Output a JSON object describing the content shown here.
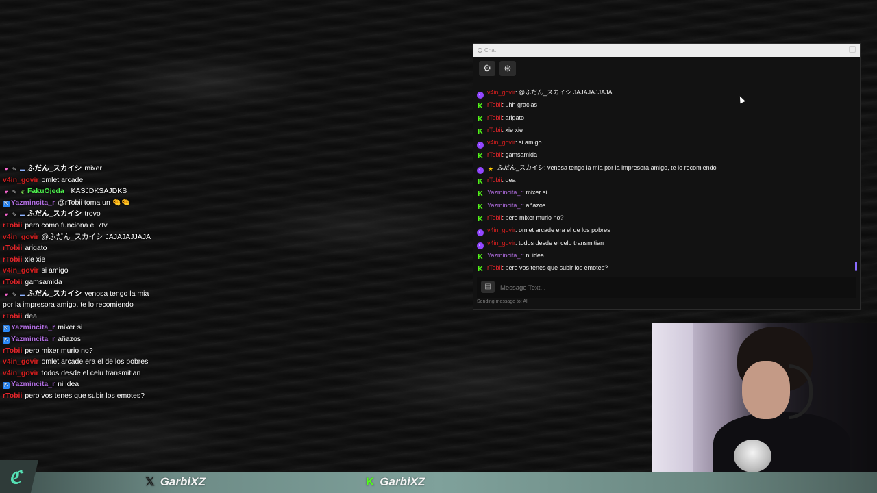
{
  "chat_window": {
    "title": "Chat",
    "input_placeholder": "Message Text...",
    "sending_to": "Sending message to: All"
  },
  "icons": {
    "settings": "gear-icon",
    "emote": "emote-icon",
    "chat_bubble": "chat-bubble-icon"
  },
  "colors": {
    "kick_green": "#53fc18",
    "twitch_purple": "#9146ff",
    "rtobii_red": "#e5262b",
    "v4in_red": "#d61f1f",
    "yazmincita_purple": "#b06ddf",
    "fakuojeda_green": "#4ef04e",
    "aqua_brand": "#55e0b4"
  },
  "messages": [
    {
      "platform": "twitch",
      "user": "v4in_govir",
      "user_color": "#d61f1f",
      "text": ": @ふだん_スカイシ JAJAJAJJAJA"
    },
    {
      "platform": "kick",
      "user": "rTobii",
      "user_color": "#e5262b",
      "text": ": uhh gracias"
    },
    {
      "platform": "kick",
      "user": "rTobii",
      "user_color": "#e5262b",
      "text": ": arigato"
    },
    {
      "platform": "kick",
      "user": "rTobii",
      "user_color": "#e5262b",
      "text": ": xie xie"
    },
    {
      "platform": "twitch",
      "user": "v4in_govir",
      "user_color": "#d61f1f",
      "text": ": si amigo"
    },
    {
      "platform": "kick",
      "user": "rTobii",
      "user_color": "#e5262b",
      "text": ": gamsamida"
    },
    {
      "platform": "twitch-star",
      "user": "ふだん_スカイシ",
      "user_color": "#ffffff",
      "text": ": venosa tengo la mia por la impresora amigo, te lo recomiendo"
    },
    {
      "platform": "kick",
      "user": "rTobii",
      "user_color": "#e5262b",
      "text": ": dea"
    },
    {
      "platform": "kick",
      "user": "Yazmincita_r",
      "user_color": "#b06ddf",
      "text": ": mixer si"
    },
    {
      "platform": "kick",
      "user": "Yazmincita_r",
      "user_color": "#b06ddf",
      "text": ": añazos"
    },
    {
      "platform": "kick",
      "user": "rTobii",
      "user_color": "#e5262b",
      "text": ": pero mixer murio no?"
    },
    {
      "platform": "twitch",
      "user": "v4in_govir",
      "user_color": "#d61f1f",
      "text": ": omlet arcade era el de los pobres"
    },
    {
      "platform": "twitch",
      "user": "v4in_govir",
      "user_color": "#d61f1f",
      "text": ": todos desde el celu transmitian"
    },
    {
      "platform": "kick",
      "user": "Yazmincita_r",
      "user_color": "#b06ddf",
      "text": ": ni idea"
    },
    {
      "platform": "kick",
      "user": "rTobii",
      "user_color": "#e5262b",
      "text": ": pero vos tenes que subir los emotes?"
    }
  ],
  "overlay_messages": [
    {
      "badges": "heart-pin-shield",
      "user": "ふだん_スカイシ",
      "user_color": "#ffffff",
      "text": "mixer"
    },
    {
      "badges": "",
      "user": "v4in_govir",
      "user_color": "#d61f1f",
      "text": "omlet arcade"
    },
    {
      "badges": "heart-pin-leaf",
      "user": "FakuOjeda_",
      "user_color": "#4ef04e",
      "text": "KASJDKSAJDKS"
    },
    {
      "badges": "kick",
      "user": "Yazmincita_r",
      "user_color": "#b06ddf",
      "text": "@rTobii toma un 🤏🤏"
    },
    {
      "badges": "heart-pin-shield",
      "user": "ふだん_スカイシ",
      "user_color": "#ffffff",
      "text": "trovo"
    },
    {
      "badges": "",
      "user": "rTobii",
      "user_color": "#e5262b",
      "text": "pero como funciona el 7tv"
    },
    {
      "badges": "",
      "user": "v4in_govir",
      "user_color": "#d61f1f",
      "text": "@ふだん_スカイシ JAJAJAJJAJA"
    },
    {
      "badges": "",
      "user": "rTobii",
      "user_color": "#e5262b",
      "text": "arigato"
    },
    {
      "badges": "",
      "user": "rTobii",
      "user_color": "#e5262b",
      "text": "xie xie"
    },
    {
      "badges": "",
      "user": "v4in_govir",
      "user_color": "#d61f1f",
      "text": "si amigo"
    },
    {
      "badges": "",
      "user": "rTobii",
      "user_color": "#e5262b",
      "text": "gamsamida"
    },
    {
      "badges": "heart-pin-shield",
      "user": "ふだん_スカイシ",
      "user_color": "#ffffff",
      "text": "venosa tengo la mia por la impresora amigo, te lo recomiendo"
    },
    {
      "badges": "",
      "user": "rTobii",
      "user_color": "#e5262b",
      "text": "dea"
    },
    {
      "badges": "kick",
      "user": "Yazmincita_r",
      "user_color": "#b06ddf",
      "text": "mixer si"
    },
    {
      "badges": "kick",
      "user": "Yazmincita_r",
      "user_color": "#b06ddf",
      "text": "añazos"
    },
    {
      "badges": "",
      "user": "rTobii",
      "user_color": "#e5262b",
      "text": "pero mixer murio no?"
    },
    {
      "badges": "",
      "user": "v4in_govir",
      "user_color": "#d61f1f",
      "text": "omlet arcade era el de los pobres"
    },
    {
      "badges": "",
      "user": "v4in_govir",
      "user_color": "#d61f1f",
      "text": "todos desde el celu transmitian"
    },
    {
      "badges": "kick",
      "user": "Yazmincita_r",
      "user_color": "#b06ddf",
      "text": "ni idea"
    },
    {
      "badges": "",
      "user": "rTobii",
      "user_color": "#e5262b",
      "text": "pero vos tenes que subir los emotes?"
    }
  ],
  "bottom_bar": {
    "x_handle": "GarbiXZ",
    "kick_handle": "GarbiXZ",
    "x_icon": "x-logo-icon",
    "kick_icon": "kick-logo-icon",
    "brand_icon": "brand-logo-icon"
  }
}
